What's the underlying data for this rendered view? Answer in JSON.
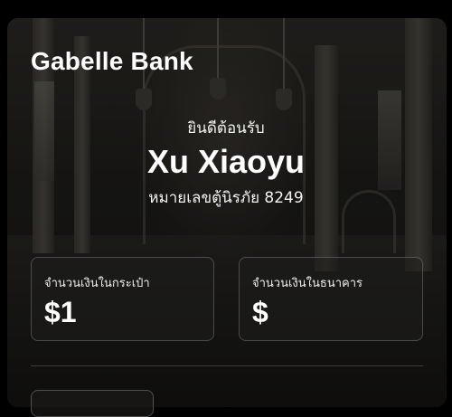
{
  "bank": {
    "name": "Gabelle Bank"
  },
  "welcome": {
    "greeting": "ยินดีต้อนรับ",
    "customer_name": "Xu Xiaoyu",
    "box_number": "หมายเลขตู้นิรภัย 8249"
  },
  "balances": {
    "wallet": {
      "label": "จำนวนเงินในกระเป๋า",
      "value": "$1"
    },
    "bank": {
      "label": "จำนวนเงินในธนาคาร",
      "value": "$"
    }
  },
  "colors": {
    "background": "#000000",
    "text": "#ffffff",
    "card_border": "#4a4a4a"
  }
}
